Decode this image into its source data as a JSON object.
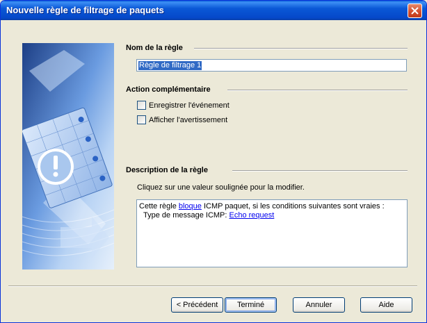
{
  "window": {
    "title": "Nouvelle règle de filtrage de paquets"
  },
  "rule_name": {
    "label": "Nom de la règle",
    "value": "Règle de filtrage 1"
  },
  "action": {
    "label": "Action complémentaire",
    "options": [
      {
        "label": "Enregistrer l'événement",
        "checked": false
      },
      {
        "label": "Afficher l'avertissement",
        "checked": false
      }
    ]
  },
  "description": {
    "label": "Description de la règle",
    "hint": "Cliquez sur une valeur soulignée pour la modifier.",
    "line1_before": "Cette règle ",
    "line1_link": "bloque",
    "line1_after": " ICMP paquet, si les conditions suivantes sont vraies :",
    "line2_before": "Type de message ICMP: ",
    "line2_link": "Echo request"
  },
  "buttons": {
    "back": "< Précédent",
    "finish": "Terminé",
    "cancel": "Annuler",
    "help": "Aide"
  },
  "colors": {
    "titlebar": "#0a58d6",
    "dialog": "#ece9d8",
    "link": "#0000ee",
    "selection": "#316ac5"
  }
}
